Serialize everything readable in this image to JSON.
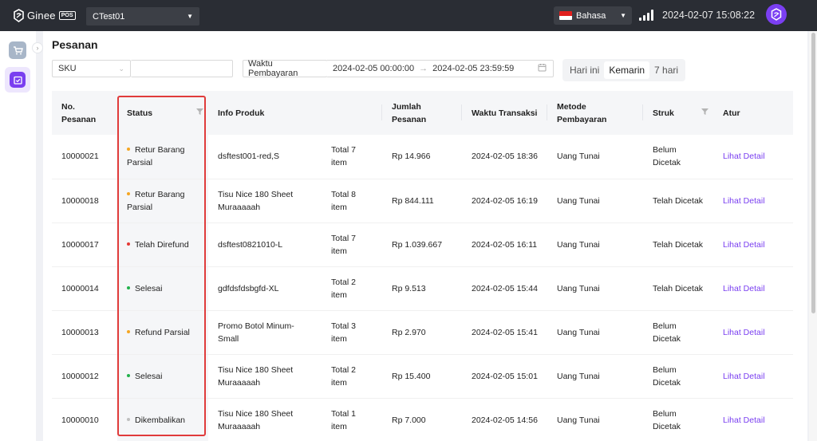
{
  "header": {
    "brand": "Ginee",
    "brand_badge": "POS",
    "store": "CTest01",
    "language": "Bahasa",
    "datetime": "2024-02-07 15:08:22"
  },
  "sidebar": {
    "items": [
      {
        "icon": "cart-icon",
        "active": false
      },
      {
        "icon": "orders-icon",
        "active": true
      }
    ]
  },
  "page": {
    "title": "Pesanan"
  },
  "filters": {
    "sku_select": "SKU",
    "sku_input_placeholder": "",
    "time_label": "Waktu Pembayaran",
    "start_time": "2024-02-05 00:00:00",
    "end_time": "2024-02-05 23:59:59",
    "quick_ranges": [
      "Hari ini",
      "Kemarin",
      "7 hari"
    ],
    "quick_active": "Kemarin"
  },
  "table": {
    "headers": [
      "No. Pesanan",
      "Status",
      "Info Produk",
      "",
      "Jumlah Pesanan",
      "Waktu Transaksi",
      "Metode Pembayaran",
      "Struk",
      "Atur"
    ],
    "rows": [
      {
        "no": "10000021",
        "status": "Retur Barang Parsial",
        "status_color": "#f5a623",
        "product": "dsftest001-red,S",
        "total": "Total 7 item",
        "amount": "Rp 14.966",
        "time": "2024-02-05 18:36",
        "payment": "Uang Tunai",
        "receipt": "Belum Dicetak",
        "action": "Lihat Detail"
      },
      {
        "no": "10000018",
        "status": "Retur Barang Parsial",
        "status_color": "#f5a623",
        "product": "Tisu Nice 180 Sheet Muraaaaah",
        "total": "Total 8 item",
        "amount": "Rp 844.111",
        "time": "2024-02-05 16:19",
        "payment": "Uang Tunai",
        "receipt": "Telah Dicetak",
        "action": "Lihat Detail"
      },
      {
        "no": "10000017",
        "status": "Telah Direfund",
        "status_color": "#e53935",
        "product": "dsftest0821010-L",
        "total": "Total 7 item",
        "amount": "Rp 1.039.667",
        "time": "2024-02-05 16:11",
        "payment": "Uang Tunai",
        "receipt": "Telah Dicetak",
        "action": "Lihat Detail"
      },
      {
        "no": "10000014",
        "status": "Selesai",
        "status_color": "#22b14c",
        "product": "gdfdsfdsbgfd-XL",
        "total": "Total 2 item",
        "amount": "Rp 9.513",
        "time": "2024-02-05 15:44",
        "payment": "Uang Tunai",
        "receipt": "Telah Dicetak",
        "action": "Lihat Detail"
      },
      {
        "no": "10000013",
        "status": "Refund Parsial",
        "status_color": "#f5a623",
        "product": "Promo Botol Minum-Small",
        "total": "Total 3 item",
        "amount": "Rp 2.970",
        "time": "2024-02-05 15:41",
        "payment": "Uang Tunai",
        "receipt": "Belum Dicetak",
        "action": "Lihat Detail"
      },
      {
        "no": "10000012",
        "status": "Selesai",
        "status_color": "#22b14c",
        "product": "Tisu Nice 180 Sheet Muraaaaah",
        "total": "Total 2 item",
        "amount": "Rp 15.400",
        "time": "2024-02-05 15:01",
        "payment": "Uang Tunai",
        "receipt": "Belum Dicetak",
        "action": "Lihat Detail"
      },
      {
        "no": "10000010",
        "status": "Dikembalikan",
        "status_color": "#bfbfbf",
        "product": "Tisu Nice 180 Sheet Muraaaaah",
        "total": "Total 1 item",
        "amount": "Rp 7.000",
        "time": "2024-02-05 14:56",
        "payment": "Uang Tunai",
        "receipt": "Belum Dicetak",
        "action": "Lihat Detail"
      }
    ]
  },
  "colors": {
    "topbar": "#2a2d34",
    "accent": "#7a3ff0",
    "highlight": "#e03b3b"
  }
}
